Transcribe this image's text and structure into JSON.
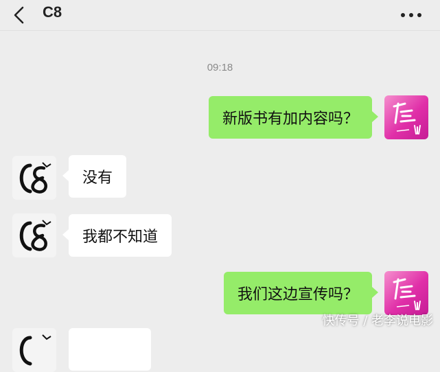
{
  "header": {
    "title": "C8",
    "back_icon": "chevron-left-icon",
    "more_icon": "more-dots-icon"
  },
  "chat": {
    "timestamp": "09:18",
    "messages": [
      {
        "side": "right",
        "text": "新版书有加内容吗？"
      },
      {
        "side": "left",
        "text": "没有"
      },
      {
        "side": "left",
        "text": "我都不知道"
      },
      {
        "side": "right",
        "text": "我们这边宣传吗？"
      }
    ]
  },
  "watermark": "快传号 / 老李说电影",
  "colors": {
    "background": "#ededed",
    "outgoing_bubble": "#95ec69",
    "incoming_bubble": "#ffffff",
    "own_avatar": "#e02fa8"
  }
}
